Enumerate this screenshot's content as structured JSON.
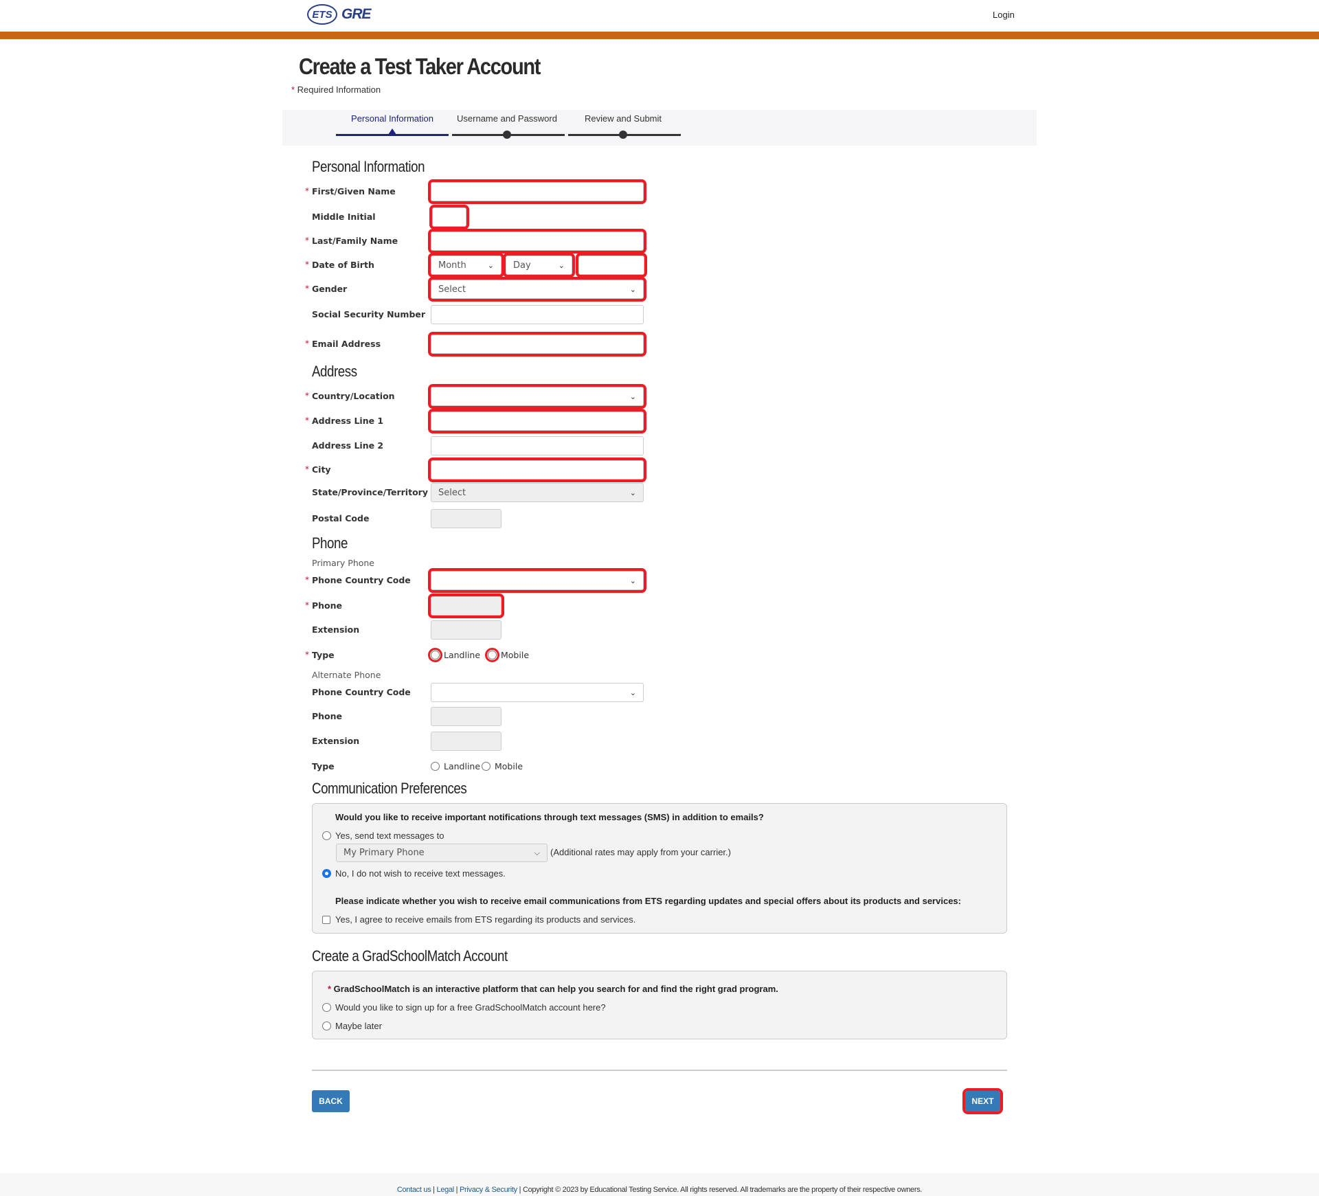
{
  "header": {
    "logo_ets": "ETS",
    "logo_gre": "GRE",
    "login": "Login",
    "accent": "#c96615"
  },
  "page": {
    "title": "Create a Test Taker Account",
    "required_note": "Required Information"
  },
  "stepper": [
    {
      "label": "Personal Information",
      "state": "current"
    },
    {
      "label": "Username and Password",
      "state": "pending"
    },
    {
      "label": "Review and Submit",
      "state": "pending"
    }
  ],
  "sections": {
    "personal": "Personal Information",
    "address": "Address",
    "phone": "Phone",
    "comm": "Communication Preferences",
    "grad": "Create a GradSchoolMatch Account"
  },
  "fields": [
    {
      "label": "First/Given Name",
      "required": true,
      "kind": "text",
      "value": "",
      "error": true
    },
    {
      "label": "Middle Initial",
      "required": false,
      "kind": "text-xs",
      "value": "",
      "error": true
    },
    {
      "label": "Last/Family Name",
      "required": true,
      "kind": "text",
      "value": "",
      "error": true
    },
    {
      "label": "Date of Birth",
      "required": true,
      "kind": "dob",
      "month": "Month",
      "day": "Day",
      "year": "",
      "error": true
    },
    {
      "label": "Gender",
      "required": true,
      "kind": "select",
      "value": "Select",
      "error": true
    },
    {
      "label": "Social Security Number",
      "required": false,
      "kind": "text",
      "value": "",
      "error": false
    },
    {
      "label": "Email Address",
      "required": true,
      "kind": "text",
      "value": "",
      "error": true
    },
    {
      "label": "Country/Location",
      "required": true,
      "kind": "select",
      "value": "",
      "error": true
    },
    {
      "label": "Address Line 1",
      "required": true,
      "kind": "text",
      "value": "",
      "error": true
    },
    {
      "label": "Address Line 2",
      "required": false,
      "kind": "text",
      "value": "",
      "error": false
    },
    {
      "label": "City",
      "required": true,
      "kind": "text",
      "value": "",
      "error": true
    },
    {
      "label": "State/Province/Territory",
      "required": false,
      "kind": "select-dis",
      "value": "Select",
      "error": false
    },
    {
      "label": "Postal Code",
      "required": false,
      "kind": "text-sm-dis",
      "value": "",
      "error": false
    },
    {
      "label": "Phone Country Code",
      "required": true,
      "kind": "select",
      "value": "",
      "error": true
    },
    {
      "label": "Phone",
      "required": true,
      "kind": "text-sm-dis",
      "value": "",
      "error": true
    },
    {
      "label": "Extension",
      "required": false,
      "kind": "text-sm-dis",
      "value": "",
      "error": false
    },
    {
      "label": "Type",
      "required": true,
      "kind": "radio",
      "options": [
        "Landline",
        "Mobile"
      ],
      "error": true
    },
    {
      "label": "Phone Country Code",
      "required": false,
      "kind": "select",
      "value": "",
      "error": false
    },
    {
      "label": "Phone",
      "required": false,
      "kind": "text-sm-dis",
      "value": "",
      "error": false
    },
    {
      "label": "Extension",
      "required": false,
      "kind": "text-sm-dis",
      "value": "",
      "error": false
    },
    {
      "label": "Type",
      "required": false,
      "kind": "radio",
      "options": [
        "Landline",
        "Mobile"
      ],
      "error": false
    }
  ],
  "phone_subs": {
    "primary": "Primary Phone",
    "alternate": "Alternate Phone"
  },
  "comm": {
    "sms_question": "Would you like to receive important notifications through text messages (SMS) in addition to emails?",
    "sms_yes": "Yes, send text messages to",
    "sms_select": "My Primary Phone",
    "sms_note": "(Additional rates may apply from your carrier.)",
    "sms_no": "No, I do not wish to receive text messages.",
    "sms_selected": "no",
    "email_question": "Please indicate whether you wish to receive email communications from ETS regarding updates and special offers about its products and services:",
    "email_agree": "Yes, I agree to receive emails from ETS regarding its products and services.",
    "email_checked": false
  },
  "grad": {
    "intro": "GradSchoolMatch is an interactive platform that can help you search for and find the right grad program.",
    "opt_yes": "Would you like to sign up for a free GradSchoolMatch account here?",
    "opt_later": "Maybe later"
  },
  "buttons": {
    "back": "BACK",
    "next": "NEXT"
  },
  "footer": {
    "contact": "Contact us",
    "legal": "Legal",
    "privacy": "Privacy & Security",
    "copyright": "Copyright © 2023 by Educational Testing Service. All rights reserved. All trademarks are the property of their respective owners."
  }
}
